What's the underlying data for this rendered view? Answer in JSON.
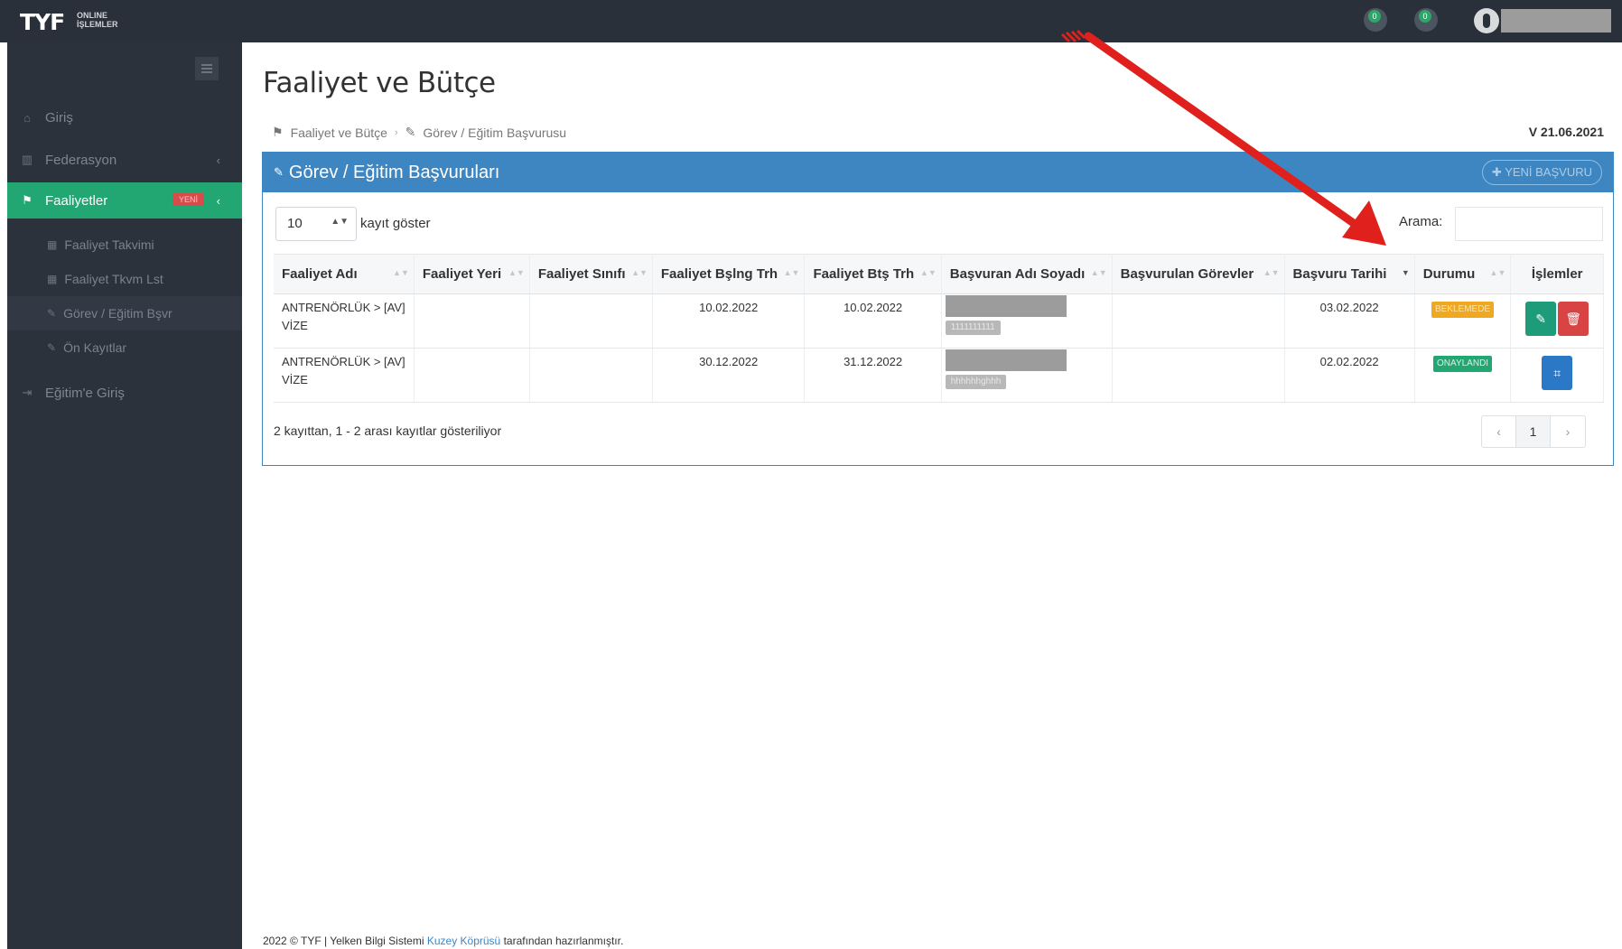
{
  "topbar": {
    "logo": "TYF",
    "logo_sub_1": "ONLINE",
    "logo_sub_2": "İŞLEMLER",
    "notif1_count": "0",
    "notif2_count": "0"
  },
  "sidebar": {
    "items": [
      {
        "label": "Giriş",
        "icon": "home-icon"
      },
      {
        "label": "Federasyon",
        "icon": "institution-icon"
      },
      {
        "label": "Faaliyetler",
        "icon": "flag-icon",
        "badge": "YENİ"
      },
      {
        "label": "Eğitim'e Giriş",
        "icon": "login-icon"
      }
    ],
    "sub_items": [
      {
        "label": "Faaliyet Takvimi",
        "icon": "calendar-icon"
      },
      {
        "label": "Faaliyet Tkvm Lst",
        "icon": "calendar-list-icon"
      },
      {
        "label": "Görev / Eğitim Bşvr",
        "icon": "edit-icon"
      },
      {
        "label": "Ön Kayıtlar",
        "icon": "edit-icon"
      }
    ]
  },
  "page": {
    "title": "Faaliyet ve Bütçe",
    "breadcrumb": [
      "Faaliyet ve Bütçe",
      "Görev / Eğitim Başvurusu"
    ],
    "version": "V 21.06.2021"
  },
  "panel": {
    "title": "Görev / Eğitim Başvuruları",
    "new_button": "YENİ BAŞVURU",
    "length_value": "10",
    "length_label": "kayıt göster",
    "search_label": "Arama:",
    "columns": [
      "Faaliyet Adı",
      "Faaliyet Yeri",
      "Faaliyet Sınıfı",
      "Faaliyet Bşlng Trh",
      "Faaliyet Btş Trh",
      "Başvuran Adı Soyadı",
      "Başvurulan Görevler",
      "Başvuru Tarihi",
      "Durumu",
      "İşlemler"
    ],
    "rows": [
      {
        "name_line1": "ANTRENÖRLÜK > [AV]",
        "name_line2": "VİZE",
        "place": "",
        "class": "",
        "start": "10.02.2022",
        "end": "10.02.2022",
        "applicant_tag": "1111111111",
        "tasks": "",
        "apply_date": "03.02.2022",
        "status": "BEKLEMEDE",
        "status_color": "#f0a820"
      },
      {
        "name_line1": "ANTRENÖRLÜK > [AV]",
        "name_line2": "VİZE",
        "place": "",
        "class": "",
        "start": "30.12.2022",
        "end": "31.12.2022",
        "applicant_tag": "hhhhhhghhh",
        "tasks": "",
        "apply_date": "02.02.2022",
        "status": "ONAYLANDI",
        "status_color": "#22a672"
      }
    ],
    "info": "2 kayıttan, 1 - 2 arası kayıtlar gösteriliyor",
    "pager": {
      "prev": "‹",
      "current": "1",
      "next": "›"
    }
  },
  "footer": {
    "prefix": "2022 © TYF | Yelken Bilgi Sistemi",
    "link": "Kuzey Köprüsü",
    "suffix": "tarafından hazırlanmıştır."
  },
  "colors": {
    "topbar": "#2a3039",
    "sidebar": "#2c323b",
    "active": "#22a672",
    "panel_header": "#3e86c2",
    "annotation_arrow": "#e0201c"
  }
}
